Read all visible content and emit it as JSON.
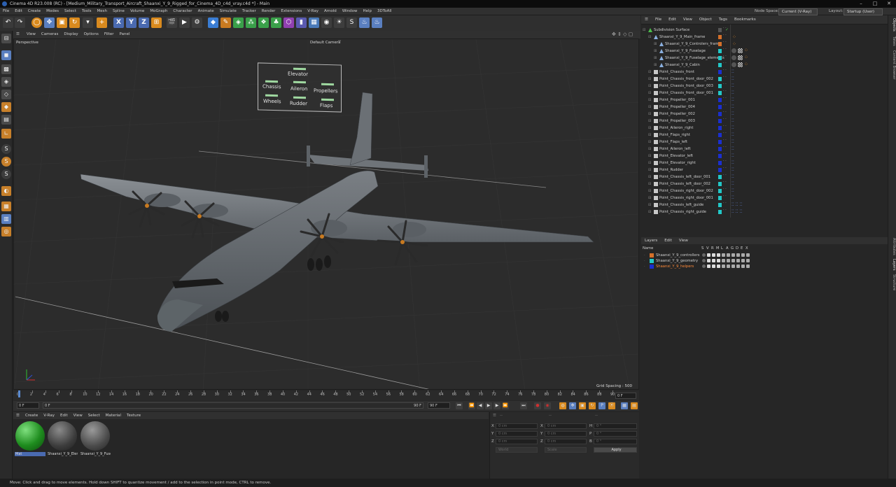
{
  "window": {
    "title": "Cinema 4D R23.008 (RC) - [Medium_Military_Transport_Aircraft_Shaanxi_Y_9_Rigged_for_Cinema_4D_c4d_vray.c4d *] - Main",
    "minimize": "–",
    "maximize": "□",
    "close": "✕"
  },
  "menubar": {
    "items": [
      "File",
      "Edit",
      "Create",
      "Modes",
      "Select",
      "Tools",
      "Mesh",
      "Spline",
      "Volume",
      "MoGraph",
      "Character",
      "Animate",
      "Simulate",
      "Tracker",
      "Render",
      "Extensions",
      "V-Ray",
      "Arnold",
      "Window",
      "Help",
      "3DToAll"
    ],
    "node_space_label": "Node Space:",
    "node_space_value": "Current (V-Ray)",
    "layout_label": "Layout:",
    "layout_value": "Startup (User)"
  },
  "toolbar": {
    "icons": [
      "undo-icon",
      "redo-icon",
      "live-selection-icon",
      "move-icon",
      "scale-icon",
      "rotate-icon",
      "recent-tools-icon",
      "add-icon",
      "x-axis-icon",
      "y-axis-icon",
      "z-axis-icon",
      "coordinate-system-icon",
      "render-view-icon",
      "render-picture-icon",
      "render-settings-icon",
      "cube-icon",
      "pen-icon",
      "subdivision-icon",
      "cloner-icon",
      "deformer-icon",
      "field-icon",
      "scene-icon",
      "camera-icon",
      "light-icon",
      "vray-logo-icon",
      "vray-render-icon",
      "vray-settings-icon"
    ],
    "axis_labels": [
      "X",
      "Y",
      "Z"
    ]
  },
  "left_tools": {
    "icons": [
      "make-editable-icon",
      "model-mode-icon",
      "texture-mode-icon",
      "point-mode-icon",
      "edge-mode-icon",
      "polygon-mode-icon",
      "uv-mode-icon",
      "axis-mode-icon",
      "snap-icon",
      "solo-icon",
      "workplane-icon",
      "locked-icon",
      "viewport-solo-icon",
      "magnet-icon",
      "grid-icon"
    ],
    "labels": [
      "S",
      "S",
      "S"
    ]
  },
  "viewport": {
    "menu": [
      "View",
      "Cameras",
      "Display",
      "Options",
      "Filter",
      "Panel"
    ],
    "label": "Perspective",
    "camera": "Default Camera",
    "camera_suffix": "°°",
    "grid_spacing": "Grid Spacing : 500 cm",
    "control_board": {
      "labels": [
        "Elevator",
        "Chassis",
        "Aileron",
        "Propellers",
        "Wheels",
        "Rudder",
        "Flaps"
      ]
    }
  },
  "timeline": {
    "ticks": [
      "0",
      "2",
      "4",
      "6",
      "8",
      "10",
      "12",
      "14",
      "16",
      "18",
      "20",
      "22",
      "24",
      "26",
      "28",
      "30",
      "32",
      "34",
      "36",
      "38",
      "40",
      "42",
      "44",
      "46",
      "48",
      "50",
      "52",
      "54",
      "56",
      "58",
      "60",
      "62",
      "64",
      "66",
      "68",
      "70",
      "72",
      "74",
      "76",
      "78",
      "80",
      "82",
      "84",
      "86",
      "88",
      "90"
    ],
    "current_frame": "0 F"
  },
  "transport": {
    "start": "0 F",
    "preview_start": "0 F",
    "preview_end": "90 F",
    "end": "90 F",
    "buttons": [
      "first-frame-icon",
      "prev-key-icon",
      "prev-frame-icon",
      "play-icon",
      "next-frame-icon",
      "next-key-icon",
      "last-frame-icon",
      "record-icon",
      "autokey-icon",
      "keyframe-selection-icon",
      "position-key-icon",
      "scale-key-icon",
      "rotation-key-icon",
      "param-key-icon",
      "pla-key-icon",
      "scheme-icon",
      "timeline-icon"
    ]
  },
  "materials": {
    "menu": [
      "Create",
      "V-Ray",
      "Edit",
      "View",
      "Select",
      "Material",
      "Texture"
    ],
    "items": [
      {
        "name": "Mat",
        "color": "#2eaa2e"
      },
      {
        "name": "Shaanxi_Y_9_Elem",
        "color": "#555"
      },
      {
        "name": "Shaanxi_Y_9_Fuse",
        "color": "#666"
      }
    ]
  },
  "coords": {
    "header_dashes": [
      "--",
      "--",
      "--"
    ],
    "rows": [
      {
        "axis": "X",
        "pos": "0 cm",
        "rot_axis": "X",
        "rot": "0 cm",
        "size_axis": "H",
        "size": "0 °"
      },
      {
        "axis": "Y",
        "pos": "0 cm",
        "rot_axis": "Y",
        "rot": "0 cm",
        "size_axis": "P",
        "size": "0 °"
      },
      {
        "axis": "Z",
        "pos": "0 cm",
        "rot_axis": "Z",
        "rot": "0 cm",
        "size_axis": "B",
        "size": "0 °"
      }
    ],
    "mode": "World",
    "size_mode": "Scale",
    "apply": "Apply"
  },
  "status": "Move: Click and drag to move elements. Hold down SHIFT to quantize movement / add to the selection in point mode, CTRL to remove.",
  "objects": {
    "menu": [
      "File",
      "Edit",
      "View",
      "Object",
      "Tags",
      "Bookmarks"
    ],
    "items": [
      {
        "name": "Subdivision Surface",
        "indent": 0,
        "icon": "#4cbe4c",
        "swatch": "",
        "tags": "check"
      },
      {
        "name": "Shaanxi_Y_9_Main_frame",
        "indent": 1,
        "icon": "#8ab0e0",
        "swatch": "#d4702a",
        "tags": "star"
      },
      {
        "name": "Shaanxi_Y_9_Controlers_frame",
        "indent": 2,
        "icon": "#8ab0e0",
        "swatch": "#d4702a",
        "tags": "star"
      },
      {
        "name": "Shaanxi_Y_9_Fuselage",
        "indent": 2,
        "icon": "#8ab0e0",
        "swatch": "#22c8c8",
        "tags": "mat"
      },
      {
        "name": "Shaanxi_Y_9_Fuselage_elements",
        "indent": 2,
        "icon": "#8ab0e0",
        "swatch": "#22c8c8",
        "tags": "mat"
      },
      {
        "name": "Shaanxi_Y_9_Cabin",
        "indent": 2,
        "icon": "#8ab0e0",
        "swatch": "#22c8c8",
        "tags": "mat"
      },
      {
        "name": "Point_Chassis_front",
        "indent": 1,
        "icon": "#c8c8c8",
        "swatch": "#1a2fd0",
        "tags": "pt"
      },
      {
        "name": "Point_Chassis_front_door_002",
        "indent": 1,
        "icon": "#c8c8c8",
        "swatch": "#22c8c8",
        "tags": "pt"
      },
      {
        "name": "Point_Chassis_front_door_003",
        "indent": 1,
        "icon": "#c8c8c8",
        "swatch": "#22c8c8",
        "tags": "pt"
      },
      {
        "name": "Point_Chassis_front_door_001",
        "indent": 1,
        "icon": "#c8c8c8",
        "swatch": "#22c8c8",
        "tags": "pt"
      },
      {
        "name": "Point_Propeller_001",
        "indent": 1,
        "icon": "#c8c8c8",
        "swatch": "#1a2fd0",
        "tags": "pt"
      },
      {
        "name": "Point_Propeller_004",
        "indent": 1,
        "icon": "#c8c8c8",
        "swatch": "#1a2fd0",
        "tags": "pt"
      },
      {
        "name": "Point_Propeller_002",
        "indent": 1,
        "icon": "#c8c8c8",
        "swatch": "#1a2fd0",
        "tags": "pt"
      },
      {
        "name": "Point_Propeller_003",
        "indent": 1,
        "icon": "#c8c8c8",
        "swatch": "#1a2fd0",
        "tags": "pt"
      },
      {
        "name": "Point_Aileron_right",
        "indent": 1,
        "icon": "#c8c8c8",
        "swatch": "#1a2fd0",
        "tags": "pt"
      },
      {
        "name": "Point_Flaps_right",
        "indent": 1,
        "icon": "#c8c8c8",
        "swatch": "#1a2fd0",
        "tags": "pt"
      },
      {
        "name": "Point_Flaps_left",
        "indent": 1,
        "icon": "#c8c8c8",
        "swatch": "#1a2fd0",
        "tags": "pt"
      },
      {
        "name": "Point_Aileron_left",
        "indent": 1,
        "icon": "#c8c8c8",
        "swatch": "#1a2fd0",
        "tags": "pt"
      },
      {
        "name": "Point_Elevator_left",
        "indent": 1,
        "icon": "#c8c8c8",
        "swatch": "#1a2fd0",
        "tags": "pt"
      },
      {
        "name": "Point_Elevator_right",
        "indent": 1,
        "icon": "#c8c8c8",
        "swatch": "#1a2fd0",
        "tags": "pt"
      },
      {
        "name": "Point_Rudder",
        "indent": 1,
        "icon": "#c8c8c8",
        "swatch": "#1a2fd0",
        "tags": "pt"
      },
      {
        "name": "Point_Chassis_left_door_001",
        "indent": 1,
        "icon": "#c8c8c8",
        "swatch": "#22c8c8",
        "tags": "pt"
      },
      {
        "name": "Point_Chassis_left_door_002",
        "indent": 1,
        "icon": "#c8c8c8",
        "swatch": "#22c8c8",
        "tags": "pt"
      },
      {
        "name": "Point_Chassis_right_door_002",
        "indent": 1,
        "icon": "#c8c8c8",
        "swatch": "#22c8c8",
        "tags": "pt"
      },
      {
        "name": "Point_Chassis_right_door_001",
        "indent": 1,
        "icon": "#c8c8c8",
        "swatch": "#22c8c8",
        "tags": "pt"
      },
      {
        "name": "Point_Chassis_left_guide",
        "indent": 1,
        "icon": "#c8c8c8",
        "swatch": "#22c8c8",
        "tags": "pt2"
      },
      {
        "name": "Point_Chassis_right_guide",
        "indent": 1,
        "icon": "#c8c8c8",
        "swatch": "#22c8c8",
        "tags": "pt2"
      }
    ]
  },
  "layers": {
    "menu": [
      "Layers",
      "Edit",
      "View"
    ],
    "header_name": "Name",
    "header_cols": [
      "S",
      "V",
      "R",
      "M",
      "L",
      "A",
      "G",
      "D",
      "E",
      "X"
    ],
    "items": [
      {
        "name": "Shaanxi_Y_9_controllers",
        "color": "#d4702a",
        "text_color": "#cfcfcf"
      },
      {
        "name": "Shaanxi_Y_9_geometry",
        "color": "#22c8c8",
        "text_color": "#cfcfcf"
      },
      {
        "name": "Shaanxi_Y_9_helpers",
        "color": "#1a2fd0",
        "text_color": "#ff8a3a"
      }
    ]
  },
  "right_tabs": [
    "Objects",
    "Takes",
    "Content Browser",
    "Attributes",
    "Layers",
    "Structure"
  ]
}
